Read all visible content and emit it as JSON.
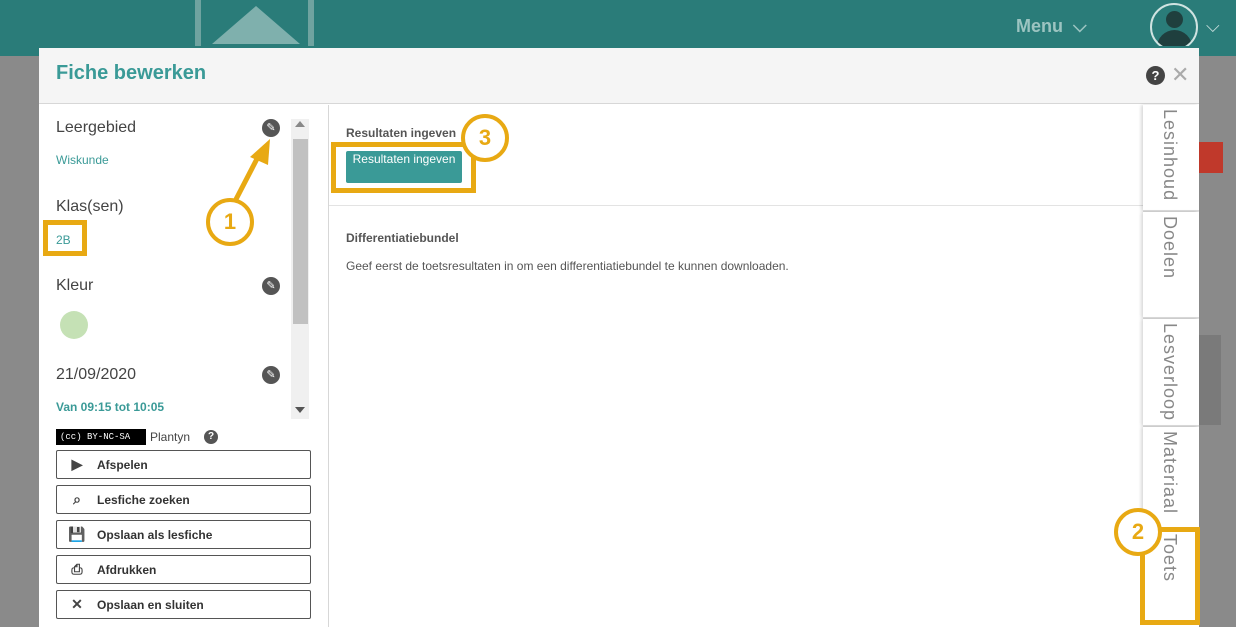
{
  "app": {
    "menu_label": "Menu",
    "menu_chevron": "⌵",
    "avatar_chevron": "⌵"
  },
  "modal": {
    "title": "Fiche bewerken",
    "help_symbol": "?",
    "close_symbol": "✕"
  },
  "sidebar": {
    "leergebied_label": "Leergebied",
    "leergebied_value": "Wiskunde",
    "klas_label": "Klas(sen)",
    "klas_value": "2B",
    "kleur_label": "Kleur",
    "kleur_color": "#c5e1b5",
    "date_label": "21/09/2020",
    "time_value": "Van 09:15 tot 10:05",
    "license_badge": "(cc) BY-NC-SA",
    "license_owner": "Plantyn",
    "license_help": "?",
    "actions": [
      {
        "label": "Afspelen",
        "icon": "play-icon",
        "glyph": "▶"
      },
      {
        "label": "Lesfiche zoeken",
        "icon": "search-document-icon",
        "glyph": "⌕"
      },
      {
        "label": "Opslaan als lesfiche",
        "icon": "save-arrow-icon",
        "glyph": "💾"
      },
      {
        "label": "Afdrukken",
        "icon": "print-icon",
        "glyph": "⎙"
      },
      {
        "label": "Opslaan en sluiten",
        "icon": "close-icon",
        "glyph": "✕"
      }
    ]
  },
  "content": {
    "results_title": "Resultaten ingeven",
    "results_button": "Resultaten ingeven",
    "diff_title": "Differentiatiebundel",
    "diff_text": "Geef eerst de toetsresultaten in om een differentiatiebundel te kunnen downloaden."
  },
  "tabs": [
    "Lesinhoud",
    "Doelen",
    "Lesverloop",
    "Materiaal",
    "Toets"
  ],
  "annotations": {
    "marker_1": "1",
    "marker_2": "2",
    "marker_3": "3",
    "highlight_color": "#e8a913"
  },
  "colors": {
    "teal_header": "#2a7c79",
    "accent": "#3a9a97"
  }
}
